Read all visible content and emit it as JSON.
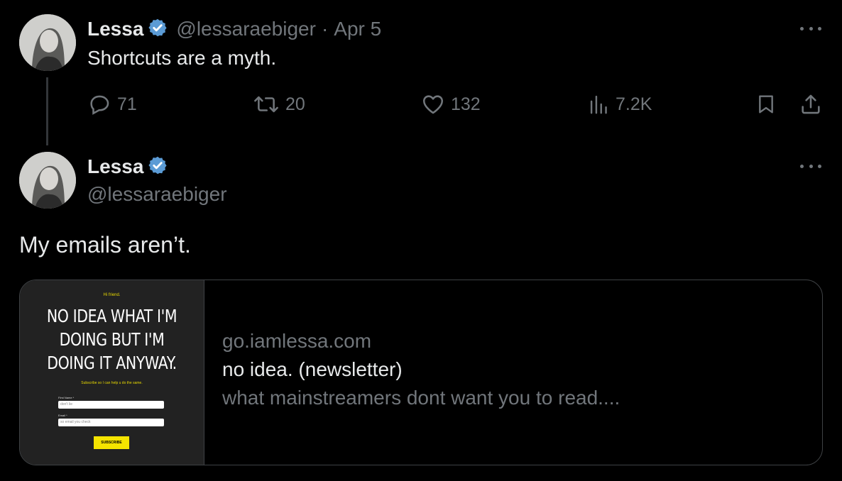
{
  "tweet1": {
    "name": "Lessa",
    "handle": "@lessaraebiger",
    "separator": "·",
    "date": "Apr 5",
    "text": "Shortcuts are a myth.",
    "replies": "71",
    "retweets": "20",
    "likes": "132",
    "views": "7.2K"
  },
  "tweet2": {
    "name": "Lessa",
    "handle": "@lessaraebiger",
    "text": "My emails aren’t."
  },
  "link_card": {
    "domain": "go.iamlessa.com",
    "title": "no idea. (newsletter)",
    "description": "what mainstreamers dont want you to read....",
    "thumbnail": {
      "greeting": "Hi friend.",
      "headline_line1": "NO IDEA WHAT I'M",
      "headline_line2": "DOING BUT I'M",
      "headline_line3": "DOING IT ANYWAY.",
      "subtitle": "Subscribe so I can help u do the same.",
      "first_name_label": "First Name *",
      "first_name_placeholder": "don't lie",
      "email_label": "Email *",
      "email_placeholder": "so email you check",
      "button": "SUBSCRIBE"
    }
  },
  "colors": {
    "background": "#000000",
    "text": "#e7e9ea",
    "muted": "#71767b",
    "verified": "#5b9bd5",
    "accent_yellow": "#f5e400"
  },
  "icons": [
    "reply-icon",
    "retweet-icon",
    "like-icon",
    "views-icon",
    "bookmark-icon",
    "share-icon",
    "verified-badge-icon",
    "more-icon"
  ]
}
